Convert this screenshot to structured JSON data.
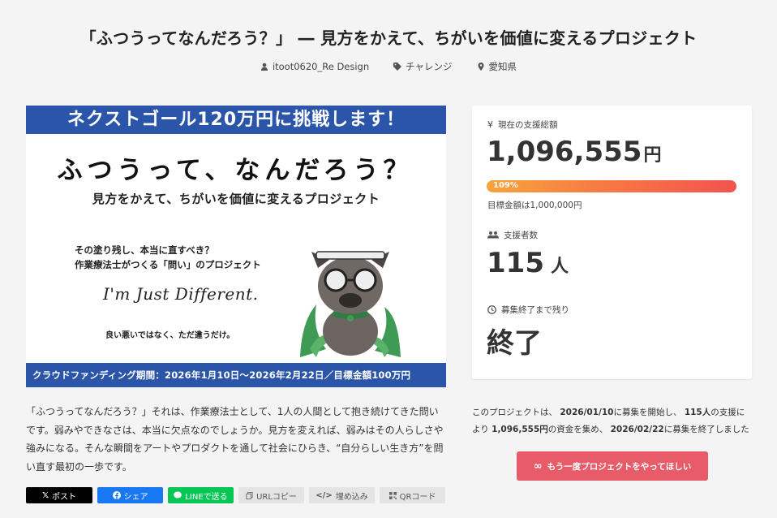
{
  "title": "「ふつうってなんだろう？」 ― 見方をかえて、ちがいを価値に変えるプロジェクト",
  "meta": {
    "author": "itoot0620_Re Design",
    "category": "チャレンジ",
    "location": "愛知県"
  },
  "banner": {
    "top": "ネクストゴール120万円に挑戦します！",
    "handwritten": "ふつうって、なんだろう？",
    "subtitle": "見方をかえて、ちがいを価値に変えるプロジェクト",
    "question1": "その塗り残し、本当に直すべき？",
    "question2": "作業療法士がつくる「問い」のプロジェクト",
    "script": "I'm Just Different.",
    "small": "良い悪いではなく、ただ違うだけ。",
    "bottom": "クラウドファンディング期間：2026年1月10日〜2026年2月22日／目標金額100万円"
  },
  "description": "「ふつうってなんだろう？」それは、作業療法士として、1人の人間として抱き続けてきた問いです。弱みやできなさは、本当に欠点なのでしょうか。見方を変えれば、弱みはその人らしさや強みになる。そんな瞬間をアートやプロダクトを通して社会にひらき、“自分らしい生き方”を問い直す最初の一歩です。",
  "share": {
    "x": "ポスト",
    "facebook": "シェア",
    "line": "LINEで送る",
    "url": "URLコピー",
    "embed": "埋め込み",
    "qr": "QRコード"
  },
  "stats": {
    "total_label": "現在の支援総額",
    "total_amount": "1,096,555",
    "currency_unit": "円",
    "progress_label": "109%",
    "progress_value": 1.0,
    "goal_text": "目標金額は1,000,000円",
    "backers_label": "支援者数",
    "backers_count": "115",
    "backers_unit": "人",
    "remaining_label": "募集終了まで残り",
    "remaining_value": "終了"
  },
  "summary": {
    "p1": "このプロジェクトは、",
    "start": "2026/01/10",
    "p2": "に募集を開始し、",
    "backers": "115人",
    "p3": "の支援により",
    "amount": "1,096,555円",
    "p4": "の資金を集め、",
    "end": "2026/02/22",
    "p5": "に募集を終了しました"
  },
  "cta": {
    "icon": "∞",
    "label": "もう一度プロジェクトをやってほしい"
  },
  "colors": {
    "banner_blue": "#2a55a8",
    "cta": "#e85b69",
    "progress_start": "#f7a43a",
    "progress_end": "#f2534e"
  }
}
